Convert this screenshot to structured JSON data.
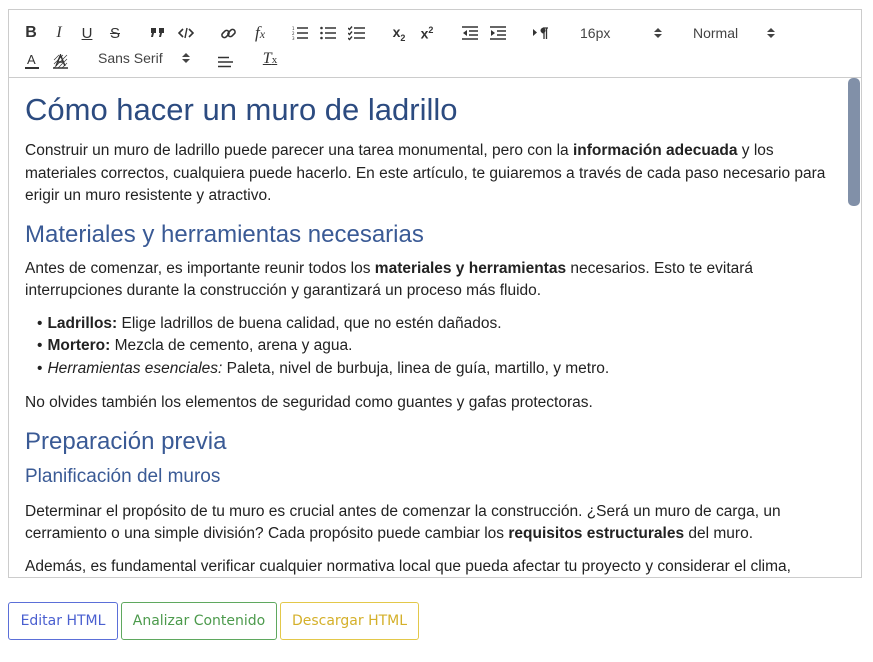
{
  "toolbar": {
    "row1": {
      "bold": "B",
      "italic": "I",
      "underline": "U",
      "strike": "S",
      "subscript_main": "x",
      "subscript_mark": "2",
      "superscript_main": "x",
      "superscript_mark": "2",
      "formula_main": "f",
      "formula_mark": "x",
      "size_value": "16px",
      "header_value": "Normal"
    },
    "row2": {
      "color_letter": "A",
      "font_value": "Sans Serif",
      "clean_main": "T",
      "clean_mark": "x"
    }
  },
  "content": {
    "title": "Cómo hacer un muro de ladrillo",
    "intro": {
      "before": "Construir un muro de ladrillo puede parecer una tarea monumental, pero con la ",
      "bold": "información adecuada",
      "after": " y los materiales correctos, cualquiera puede hacerlo. En este artículo, te guiaremos a través de cada paso necesario para erigir un muro resistente y atractivo."
    },
    "section1": {
      "heading": "Materiales y herramientas necesarias",
      "para": {
        "before": "Antes de comenzar, es importante reunir todos los ",
        "bold": "materiales y herramientas",
        "after": " necesarios. Esto te evitará interrupciones durante la construcción y garantizará un proceso más fluido."
      },
      "list": [
        {
          "lead": "Ladrillos:",
          "text": " Elige ladrillos de buena calidad, que no estén dañados."
        },
        {
          "lead": "Mortero:",
          "text": " Mezcla de cemento, arena y agua."
        },
        {
          "lead": "Herramientas esenciales:",
          "text": " Paleta, nivel de burbuja, linea de guía, martillo, y metro."
        }
      ],
      "note": "No olvides también los elementos de seguridad como guantes y gafas protectoras."
    },
    "section2": {
      "heading": "Preparación previa",
      "subheading": "Planificación del muros",
      "para1": {
        "before": "Determinar el propósito de tu muro es crucial antes de comenzar la construcción. ¿Será un muro de carga, un cerramiento o una simple división? Cada propósito puede cambiar los ",
        "bold": "requisitos estructurales",
        "after": " del muro."
      },
      "para2": "Además, es fundamental verificar cualquier normativa local que pueda afectar tu proyecto y considerar el clima,"
    }
  },
  "actions": {
    "edit_html": "Editar HTML",
    "analyze": "Analizar Contenido",
    "download": "Descargar HTML"
  },
  "colors": {
    "heading": "#2c4b80",
    "scroll_thumb": "#8190a8",
    "edit_button": "#4a5fd0",
    "analyze_button": "#4c9a4c",
    "download_button": "#d4b02a"
  },
  "icons": [
    "bold-icon",
    "italic-icon",
    "underline-icon",
    "strikethrough-icon",
    "blockquote-icon",
    "code-block-icon",
    "link-icon",
    "formula-icon",
    "ordered-list-icon",
    "bullet-list-icon",
    "checklist-icon",
    "subscript-icon",
    "superscript-icon",
    "outdent-icon",
    "indent-icon",
    "text-direction-icon",
    "text-color-icon",
    "background-color-icon",
    "align-icon",
    "clear-format-icon"
  ]
}
